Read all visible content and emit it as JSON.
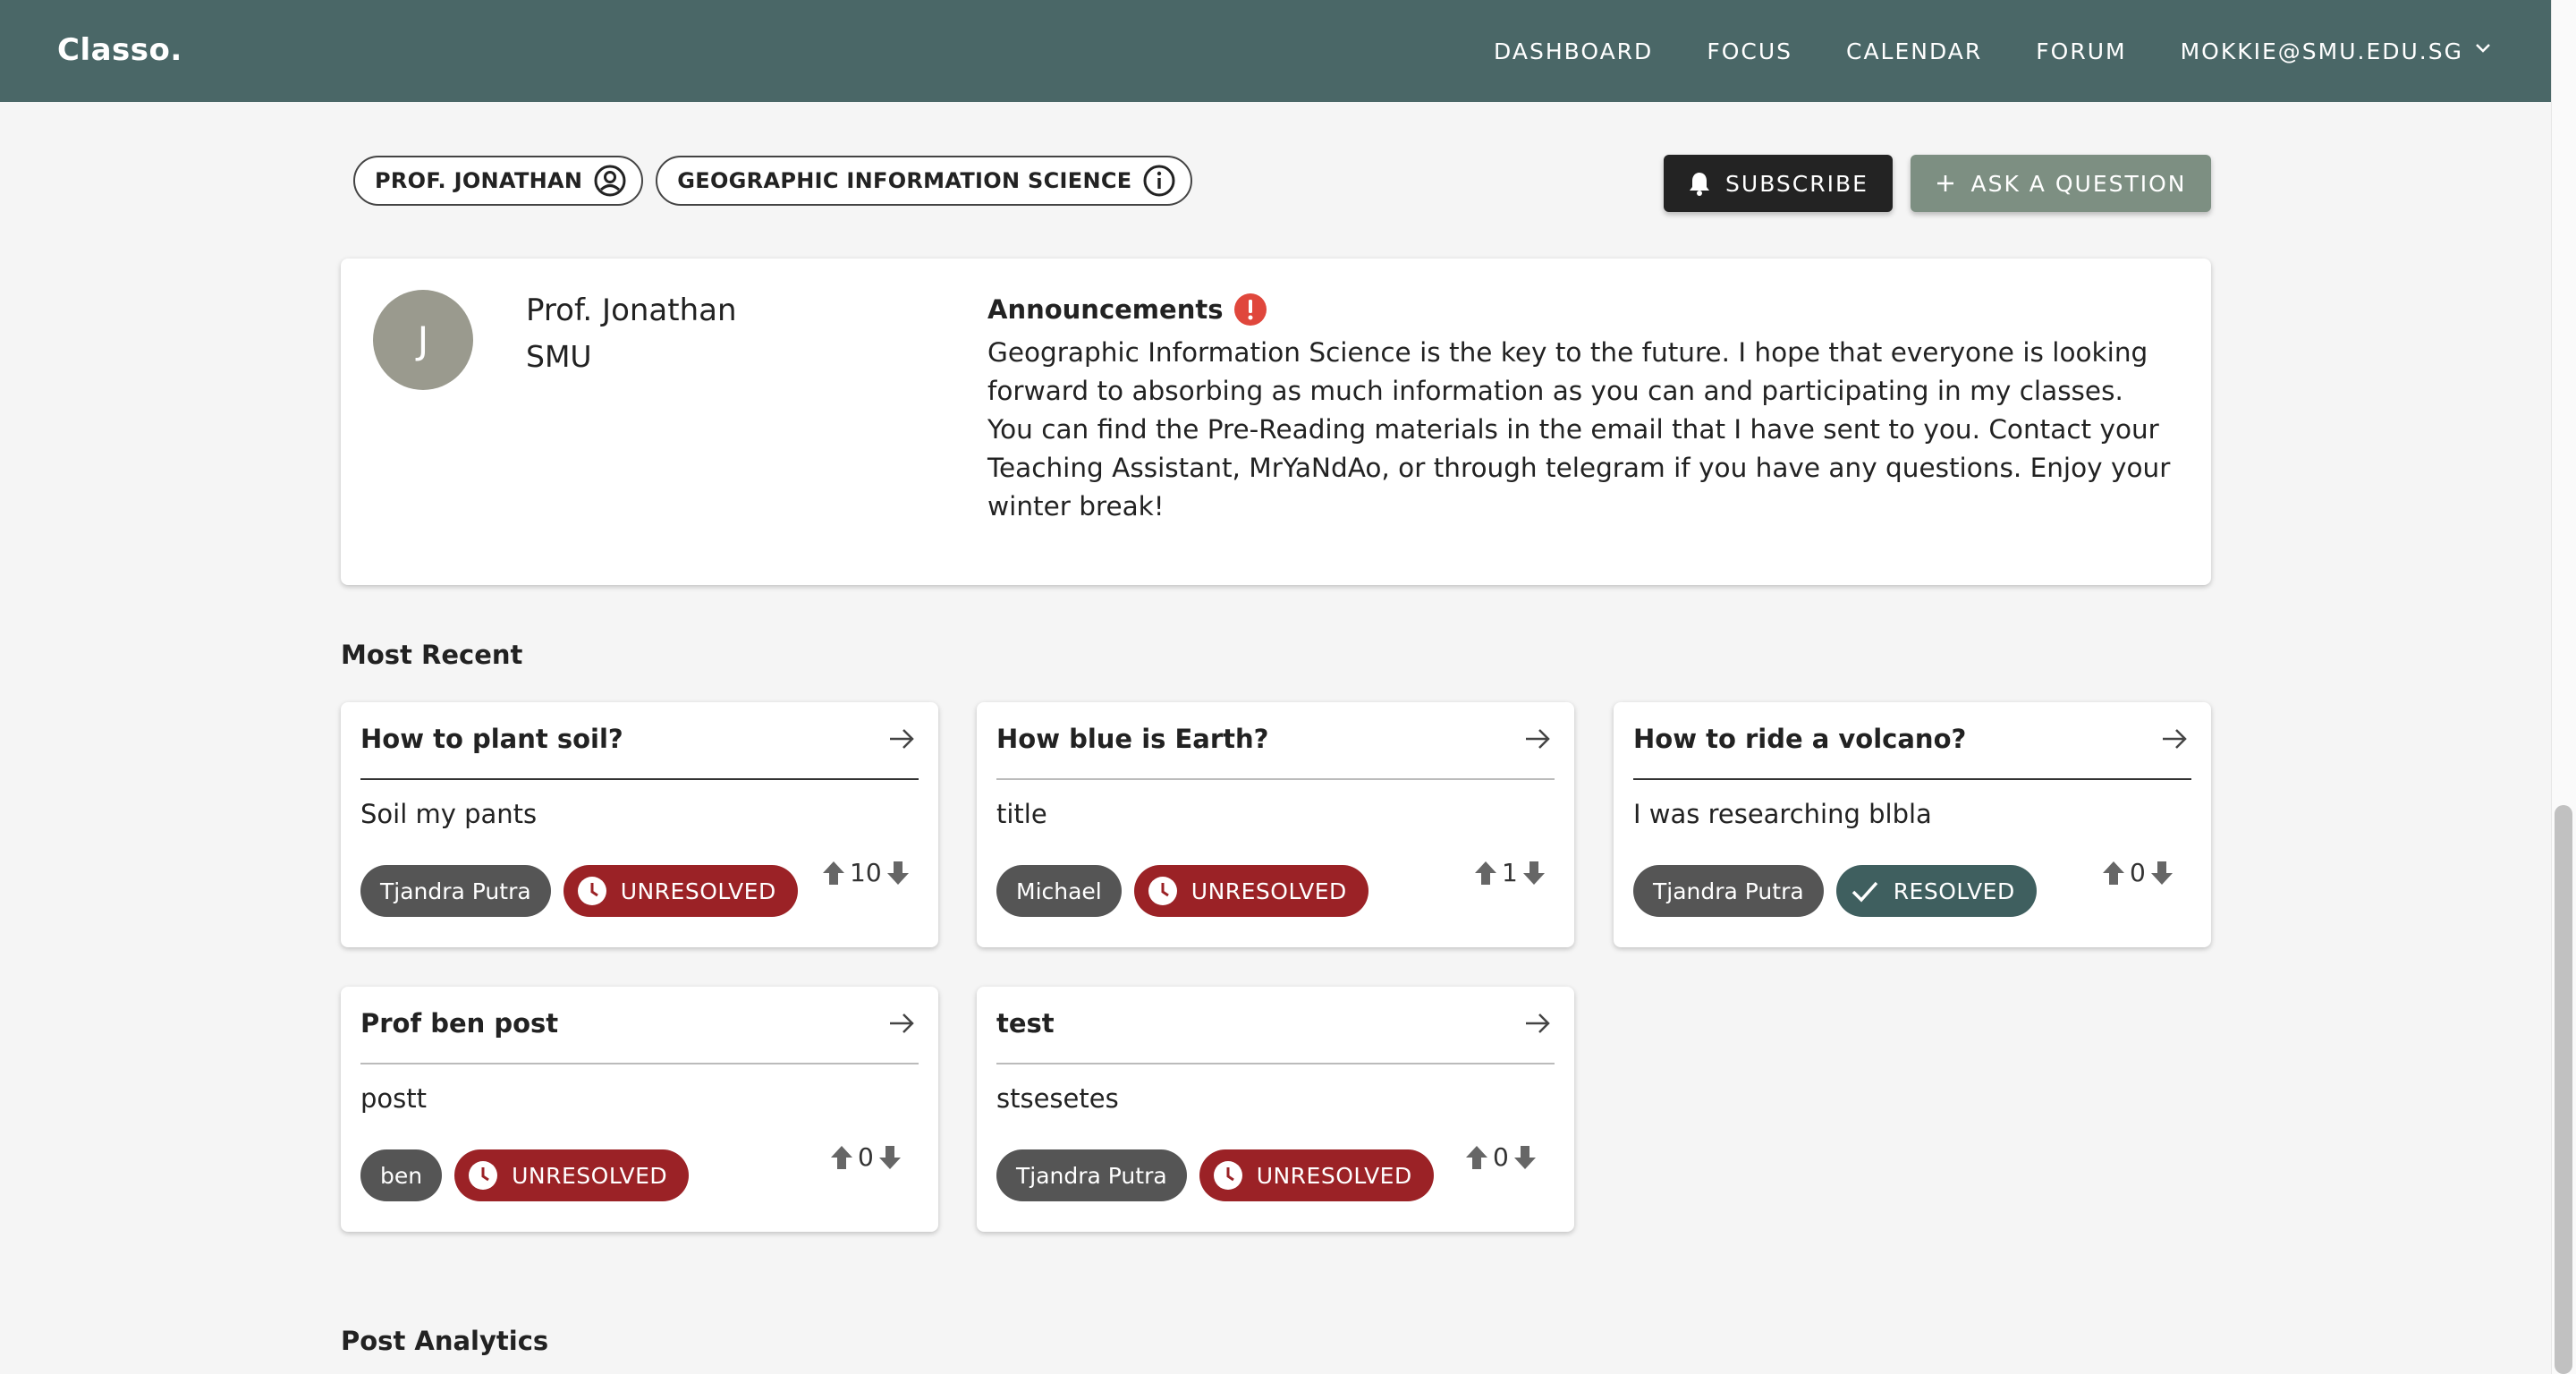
{
  "header": {
    "brand": "Classo.",
    "nav": [
      "DASHBOARD",
      "FOCUS",
      "CALENDAR",
      "FORUM"
    ],
    "user_email": "MOKKIE@SMU.EDU.SG",
    "bg_color": "#4a6767"
  },
  "chips": {
    "professor": "PROF. JONATHAN",
    "course": "GEOGRAPHIC INFORMATION SCIENCE"
  },
  "actions": {
    "subscribe": "SUBSCRIBE",
    "ask": "ASK A QUESTION"
  },
  "profile": {
    "avatar_letter": "J",
    "name": "Prof. Jonathan",
    "org": "SMU",
    "announcements_title": "Announcements",
    "announcement": "Geographic Information Science is the key to the future. I hope that everyone is looking forward to absorbing as much information as you can and participating in my classes. You can find the Pre-Reading materials in the email that I have sent to you. Contact your Teaching Assistant, MrYaNdAo, or through telegram if you have any questions. Enjoy your winter break!"
  },
  "sections": {
    "recent": "Most Recent",
    "analytics": "Post Analytics"
  },
  "posts": [
    {
      "title": "How to plant soil?",
      "body": "Soil my pants",
      "author": "Tjandra Putra",
      "status": "UNRESOLVED",
      "votes": "10"
    },
    {
      "title": "How blue is Earth?",
      "body": "title",
      "author": "Michael",
      "status": "UNRESOLVED",
      "votes": "1"
    },
    {
      "title": "How to ride a volcano?",
      "body": "I was researching blbla",
      "author": "Tjandra Putra",
      "status": "RESOLVED",
      "votes": "0"
    },
    {
      "title": "Prof ben post",
      "body": "postt",
      "author": "ben",
      "status": "UNRESOLVED",
      "votes": "0"
    },
    {
      "title": "test",
      "body": "stsesetes",
      "author": "Tjandra Putra",
      "status": "UNRESOLVED",
      "votes": "0"
    }
  ],
  "colors": {
    "unresolved": "#9b2226",
    "resolved": "#3f5f5f",
    "author_chip": "#555555"
  }
}
